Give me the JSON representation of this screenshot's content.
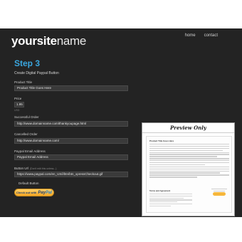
{
  "header": {
    "logo_bold": "yoursite",
    "logo_light": "name",
    "nav": [
      "home",
      "contact"
    ]
  },
  "main": {
    "step_title": "Step 3",
    "subtitle": "Create Digital Paypal Button",
    "fields": {
      "product_title": {
        "label": "Product Title",
        "value": "Product Title Goes Here"
      },
      "price": {
        "label": "Price",
        "value": "1.95",
        "hint": "USD"
      },
      "successful_order": {
        "label": "Successful Order",
        "value": "http://www.domainname.com/thankyoupage.html"
      },
      "cancelled_order": {
        "label": "Cancelled Order",
        "value": "http://www.domainname.com/"
      },
      "paypal_email": {
        "label": "Paypal Email Address",
        "value": "Paypal Email Address"
      },
      "button_url": {
        "label": "Button Url",
        "note": "(Don't edit this unless...)",
        "value": "https://www.paypal.com/en_US/i/btn/btn_xpressCheckout.gif"
      }
    },
    "default_button_label": "Default Button",
    "paypal_button": {
      "check_out_with": "Check out with",
      "pay": "Pay",
      "pal": "Pal"
    }
  },
  "preview": {
    "header": "Preview Only",
    "page_title": "Product Title Goes Here",
    "terms_heading": "Terms and Agreement"
  },
  "colors": {
    "background": "#232323",
    "accent": "#3aa7e0",
    "paypal_gold": "#f6a623"
  }
}
